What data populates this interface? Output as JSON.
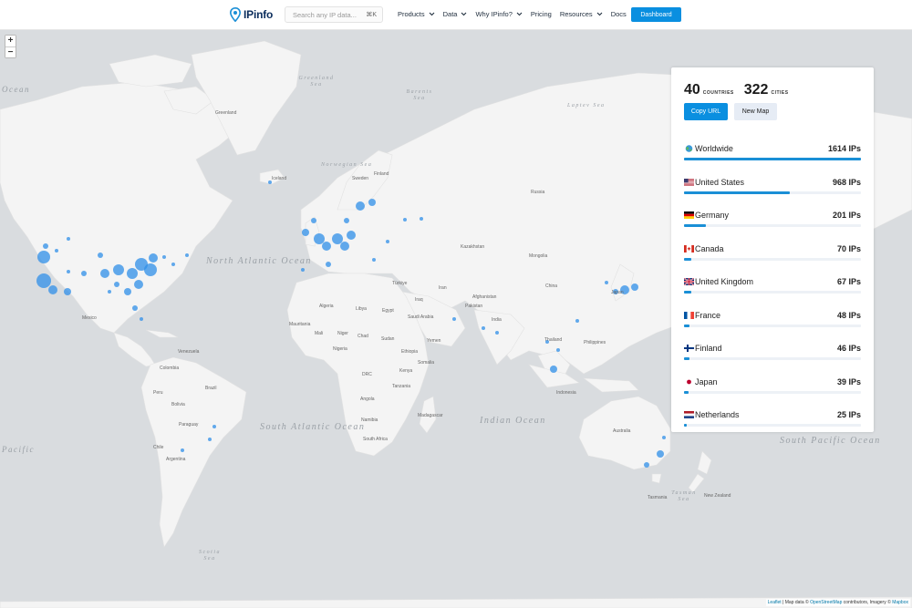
{
  "header": {
    "logo_text": "IPinfo",
    "search_placeholder": "Search any IP data...",
    "search_shortcut": "⌘K",
    "nav": [
      {
        "label": "Products",
        "has_dropdown": true
      },
      {
        "label": "Data",
        "has_dropdown": true
      },
      {
        "label": "Why IPinfo?",
        "has_dropdown": true
      },
      {
        "label": "Pricing",
        "has_dropdown": false
      },
      {
        "label": "Resources",
        "has_dropdown": true
      },
      {
        "label": "Docs",
        "has_dropdown": false
      }
    ],
    "dashboard_label": "Dashboard"
  },
  "map": {
    "zoom_in": "+",
    "zoom_out": "−",
    "oceans": {
      "n_atlantic": "North Atlantic Ocean",
      "s_atlantic": "South Atlantic Ocean",
      "indian": "Indian Ocean",
      "s_pacific": "South Pacific Ocean",
      "ocean_left": "Ocean",
      "pacific_left": "Pacific",
      "greenland_sea": "Greenland Sea",
      "barents_sea": "Barents Sea",
      "norwegian_sea": "Norwegian Sea",
      "laptev_sea": "Laptev Sea",
      "scotia_sea": "Scotia Sea",
      "tasman_sea": "Tasman Sea"
    },
    "countries": {
      "greenland": "Greenland",
      "iceland": "Iceland",
      "sweden": "Sweden",
      "finland": "Finland",
      "russia": "Russia",
      "kazakhstan": "Kazakhstan",
      "mongolia": "Mongolia",
      "china": "China",
      "india": "India",
      "iran": "Iran",
      "saudi_arabia": "Saudi Arabia",
      "egypt": "Egypt",
      "libya": "Libya",
      "algeria": "Algeria",
      "mali": "Mali",
      "niger": "Niger",
      "chad": "Chad",
      "sudan": "Sudan",
      "ethiopia": "Ethiopia",
      "nigeria": "Nigeria",
      "drc": "DRC",
      "kenya": "Kenya",
      "tanzania": "Tanzania",
      "angola": "Angola",
      "namibia": "Namibia",
      "south_africa": "South Africa",
      "madagascar": "Madagascar",
      "mexico": "Mexico",
      "colombia": "Colombia",
      "peru": "Peru",
      "brazil": "Brazil",
      "bolivia": "Bolivia",
      "paraguay": "Paraguay",
      "argentina": "Argentina",
      "chile": "Chile",
      "venezuela": "Venezuela",
      "australia": "Australia",
      "new_zealand": "New Zealand",
      "indonesia": "Indonesia",
      "thailand": "Thailand",
      "philippines": "Philippines",
      "japan": "Japan",
      "pakistan": "Pakistan",
      "afghanistan": "Afghanistan",
      "turkey": "Türkiye",
      "iraq": "Iraq",
      "mauritania": "Mauritania",
      "yemen": "Yemen",
      "somalia": "Somalia",
      "tasmania": "Tasmania"
    },
    "attribution": {
      "leaflet": "Leaflet",
      "text": " | Map data © ",
      "osm": "OpenStreetMap",
      "text2": " contributors, Imagery © ",
      "mapbox": "Mapbox"
    }
  },
  "panel": {
    "countries_count": "40",
    "countries_label": "COUNTRIES",
    "cities_count": "322",
    "cities_label": "CITIES",
    "copy_url_label": "Copy URL",
    "new_map_label": "New Map",
    "rows": [
      {
        "flag": "globe-icon",
        "name": "Worldwide",
        "count": "1614 IPs",
        "value": 1614
      },
      {
        "flag": "us-flag-icon",
        "name": "United States",
        "count": "968 IPs",
        "value": 968
      },
      {
        "flag": "de-flag-icon",
        "name": "Germany",
        "count": "201 IPs",
        "value": 201
      },
      {
        "flag": "ca-flag-icon",
        "name": "Canada",
        "count": "70 IPs",
        "value": 70
      },
      {
        "flag": "gb-flag-icon",
        "name": "United Kingdom",
        "count": "67 IPs",
        "value": 67
      },
      {
        "flag": "fr-flag-icon",
        "name": "France",
        "count": "48 IPs",
        "value": 48
      },
      {
        "flag": "fi-flag-icon",
        "name": "Finland",
        "count": "46 IPs",
        "value": 46
      },
      {
        "flag": "jp-flag-icon",
        "name": "Japan",
        "count": "39 IPs",
        "value": 39
      },
      {
        "flag": "nl-flag-icon",
        "name": "Netherlands",
        "count": "25 IPs",
        "value": 25
      }
    ]
  },
  "colors": {
    "accent": "#0a8fe0",
    "bar": "#1a8fd6",
    "dot": "#2f8fe8",
    "ocean": "#d9dcdf",
    "land": "#f4f4f4"
  }
}
